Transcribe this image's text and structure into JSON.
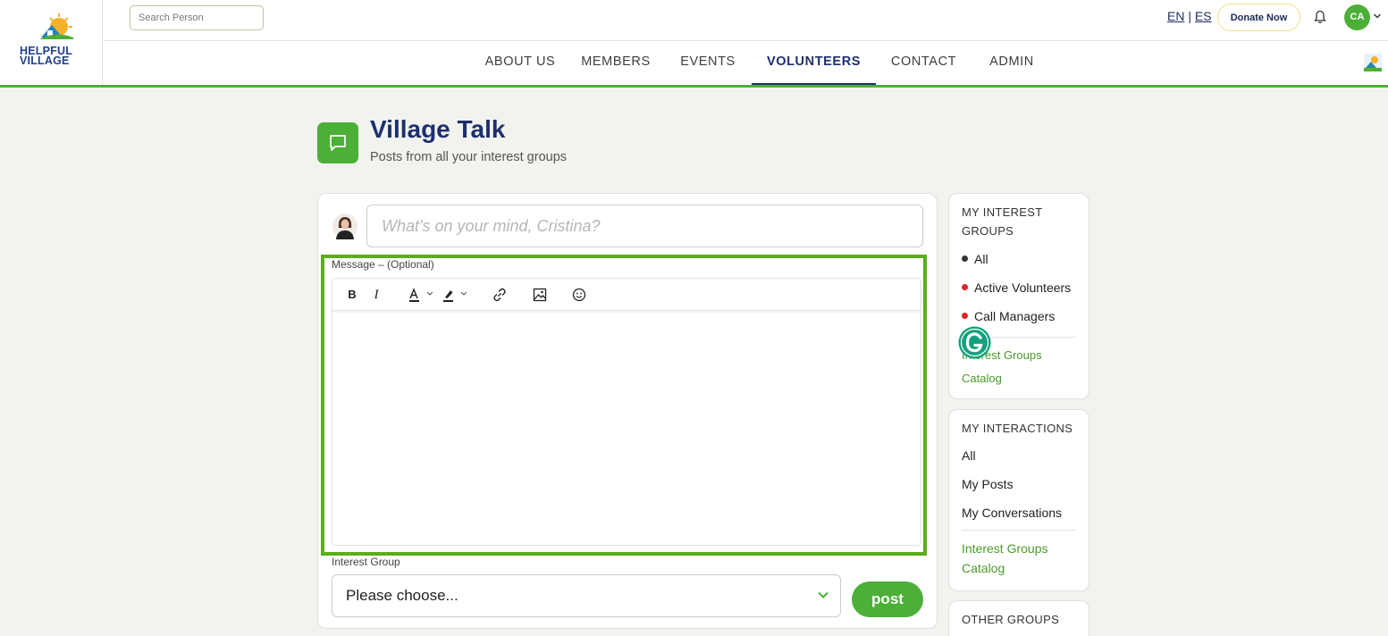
{
  "brand": {
    "line1": "HELPFUL",
    "line2": "VILLAGE"
  },
  "topbar": {
    "search_placeholder": "Search Person",
    "lang_en": "EN",
    "lang_sep": "|",
    "lang_es": "ES",
    "donate_label": "Donate Now",
    "avatar_initials": "CA"
  },
  "nav": {
    "items": [
      "ABOUT US",
      "MEMBERS",
      "EVENTS",
      "VOLUNTEERS",
      "CONTACT",
      "ADMIN"
    ],
    "active": "VOLUNTEERS"
  },
  "page": {
    "title": "Village Talk",
    "subtitle": "Posts from all your interest groups"
  },
  "composer": {
    "mind_placeholder": "What's on your mind, Cristina?",
    "message_label": "Message – (Optional)",
    "interest_group_label": "Interest Group",
    "select_value": "Please choose...",
    "post_label": "post"
  },
  "sidebar": {
    "groups_heading_1": "MY INTEREST",
    "groups_heading_2": "GROUPS",
    "groups": [
      {
        "label": "All",
        "dot_color": "#333333"
      },
      {
        "label": "Active Volunteers",
        "dot_color": "#e02424"
      },
      {
        "label": "Call Managers",
        "dot_color": "#e02424"
      }
    ],
    "groups_catalog_1": "Interest Groups",
    "groups_catalog_2": "Catalog",
    "interactions_heading": "MY INTERACTIONS",
    "interactions": [
      "All",
      "My Posts",
      "My Conversations"
    ],
    "interactions_catalog_1": "Interest Groups",
    "interactions_catalog_2": "Catalog",
    "other_heading": "OTHER GROUPS"
  },
  "colors": {
    "accent_green": "#4caf38",
    "navy": "#1e2f6e",
    "highlight_border": "#5aae1e"
  }
}
